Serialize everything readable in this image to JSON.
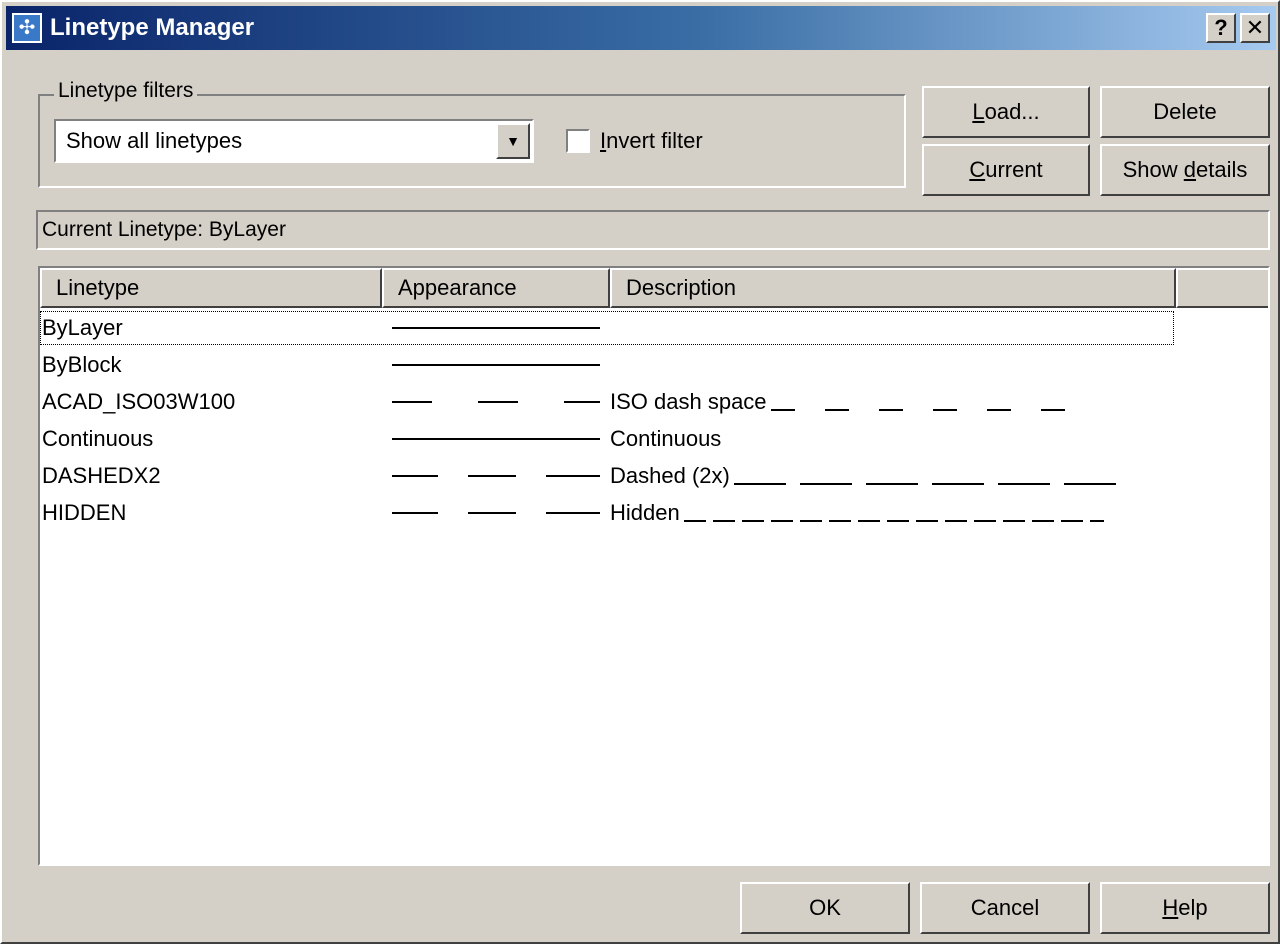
{
  "window": {
    "title": "Linetype Manager",
    "help_glyph": "?",
    "close_glyph": "✕",
    "icon": "linetype-manager-icon"
  },
  "filters": {
    "legend": "Linetype filters",
    "selected": "Show all linetypes",
    "invert_label": "Invert filter",
    "invert_checked": false
  },
  "buttons": {
    "load": "Load...",
    "delete": "Delete",
    "current": "Current",
    "show_details": "Show details",
    "ok": "OK",
    "cancel": "Cancel",
    "help": "Help"
  },
  "current_linetype_text": "Current Linetype:  ByLayer",
  "table": {
    "columns": [
      "Linetype",
      "Appearance",
      "Description"
    ],
    "rows": [
      {
        "name": "ByLayer",
        "appearance": "solid",
        "description": ""
      },
      {
        "name": "ByBlock",
        "appearance": "solid",
        "description": ""
      },
      {
        "name": "ACAD_ISO03W100",
        "appearance": "iso-dash-space",
        "description": "ISO dash space",
        "desc_pattern": "iso-dash-space"
      },
      {
        "name": "Continuous",
        "appearance": "solid",
        "description": "Continuous"
      },
      {
        "name": "DASHEDX2",
        "appearance": "dashed",
        "description": "Dashed (2x)",
        "desc_pattern": "dashed"
      },
      {
        "name": "HIDDEN",
        "appearance": "dashed",
        "description": "Hidden",
        "desc_pattern": "hidden"
      }
    ]
  }
}
